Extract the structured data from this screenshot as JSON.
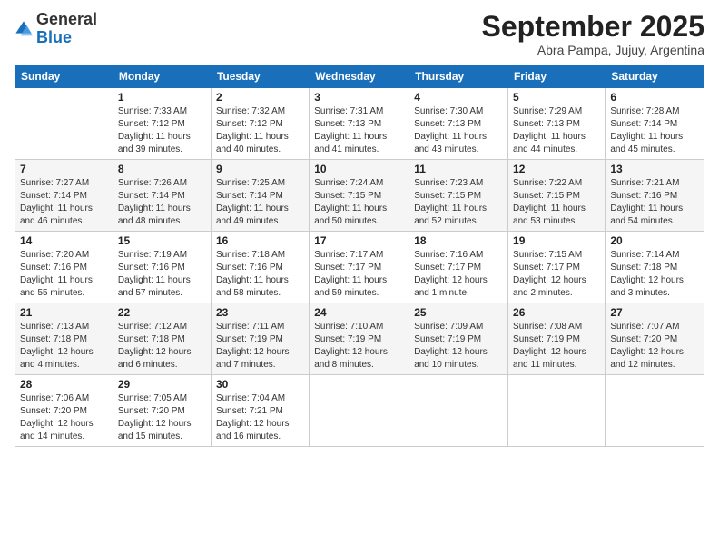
{
  "logo": {
    "general": "General",
    "blue": "Blue"
  },
  "title": "September 2025",
  "subtitle": "Abra Pampa, Jujuy, Argentina",
  "days_header": [
    "Sunday",
    "Monday",
    "Tuesday",
    "Wednesday",
    "Thursday",
    "Friday",
    "Saturday"
  ],
  "weeks": [
    [
      {
        "day": "",
        "info": ""
      },
      {
        "day": "1",
        "info": "Sunrise: 7:33 AM\nSunset: 7:12 PM\nDaylight: 11 hours\nand 39 minutes."
      },
      {
        "day": "2",
        "info": "Sunrise: 7:32 AM\nSunset: 7:12 PM\nDaylight: 11 hours\nand 40 minutes."
      },
      {
        "day": "3",
        "info": "Sunrise: 7:31 AM\nSunset: 7:13 PM\nDaylight: 11 hours\nand 41 minutes."
      },
      {
        "day": "4",
        "info": "Sunrise: 7:30 AM\nSunset: 7:13 PM\nDaylight: 11 hours\nand 43 minutes."
      },
      {
        "day": "5",
        "info": "Sunrise: 7:29 AM\nSunset: 7:13 PM\nDaylight: 11 hours\nand 44 minutes."
      },
      {
        "day": "6",
        "info": "Sunrise: 7:28 AM\nSunset: 7:14 PM\nDaylight: 11 hours\nand 45 minutes."
      }
    ],
    [
      {
        "day": "7",
        "info": "Sunrise: 7:27 AM\nSunset: 7:14 PM\nDaylight: 11 hours\nand 46 minutes."
      },
      {
        "day": "8",
        "info": "Sunrise: 7:26 AM\nSunset: 7:14 PM\nDaylight: 11 hours\nand 48 minutes."
      },
      {
        "day": "9",
        "info": "Sunrise: 7:25 AM\nSunset: 7:14 PM\nDaylight: 11 hours\nand 49 minutes."
      },
      {
        "day": "10",
        "info": "Sunrise: 7:24 AM\nSunset: 7:15 PM\nDaylight: 11 hours\nand 50 minutes."
      },
      {
        "day": "11",
        "info": "Sunrise: 7:23 AM\nSunset: 7:15 PM\nDaylight: 11 hours\nand 52 minutes."
      },
      {
        "day": "12",
        "info": "Sunrise: 7:22 AM\nSunset: 7:15 PM\nDaylight: 11 hours\nand 53 minutes."
      },
      {
        "day": "13",
        "info": "Sunrise: 7:21 AM\nSunset: 7:16 PM\nDaylight: 11 hours\nand 54 minutes."
      }
    ],
    [
      {
        "day": "14",
        "info": "Sunrise: 7:20 AM\nSunset: 7:16 PM\nDaylight: 11 hours\nand 55 minutes."
      },
      {
        "day": "15",
        "info": "Sunrise: 7:19 AM\nSunset: 7:16 PM\nDaylight: 11 hours\nand 57 minutes."
      },
      {
        "day": "16",
        "info": "Sunrise: 7:18 AM\nSunset: 7:16 PM\nDaylight: 11 hours\nand 58 minutes."
      },
      {
        "day": "17",
        "info": "Sunrise: 7:17 AM\nSunset: 7:17 PM\nDaylight: 11 hours\nand 59 minutes."
      },
      {
        "day": "18",
        "info": "Sunrise: 7:16 AM\nSunset: 7:17 PM\nDaylight: 12 hours\nand 1 minute."
      },
      {
        "day": "19",
        "info": "Sunrise: 7:15 AM\nSunset: 7:17 PM\nDaylight: 12 hours\nand 2 minutes."
      },
      {
        "day": "20",
        "info": "Sunrise: 7:14 AM\nSunset: 7:18 PM\nDaylight: 12 hours\nand 3 minutes."
      }
    ],
    [
      {
        "day": "21",
        "info": "Sunrise: 7:13 AM\nSunset: 7:18 PM\nDaylight: 12 hours\nand 4 minutes."
      },
      {
        "day": "22",
        "info": "Sunrise: 7:12 AM\nSunset: 7:18 PM\nDaylight: 12 hours\nand 6 minutes."
      },
      {
        "day": "23",
        "info": "Sunrise: 7:11 AM\nSunset: 7:19 PM\nDaylight: 12 hours\nand 7 minutes."
      },
      {
        "day": "24",
        "info": "Sunrise: 7:10 AM\nSunset: 7:19 PM\nDaylight: 12 hours\nand 8 minutes."
      },
      {
        "day": "25",
        "info": "Sunrise: 7:09 AM\nSunset: 7:19 PM\nDaylight: 12 hours\nand 10 minutes."
      },
      {
        "day": "26",
        "info": "Sunrise: 7:08 AM\nSunset: 7:19 PM\nDaylight: 12 hours\nand 11 minutes."
      },
      {
        "day": "27",
        "info": "Sunrise: 7:07 AM\nSunset: 7:20 PM\nDaylight: 12 hours\nand 12 minutes."
      }
    ],
    [
      {
        "day": "28",
        "info": "Sunrise: 7:06 AM\nSunset: 7:20 PM\nDaylight: 12 hours\nand 14 minutes."
      },
      {
        "day": "29",
        "info": "Sunrise: 7:05 AM\nSunset: 7:20 PM\nDaylight: 12 hours\nand 15 minutes."
      },
      {
        "day": "30",
        "info": "Sunrise: 7:04 AM\nSunset: 7:21 PM\nDaylight: 12 hours\nand 16 minutes."
      },
      {
        "day": "",
        "info": ""
      },
      {
        "day": "",
        "info": ""
      },
      {
        "day": "",
        "info": ""
      },
      {
        "day": "",
        "info": ""
      }
    ]
  ]
}
